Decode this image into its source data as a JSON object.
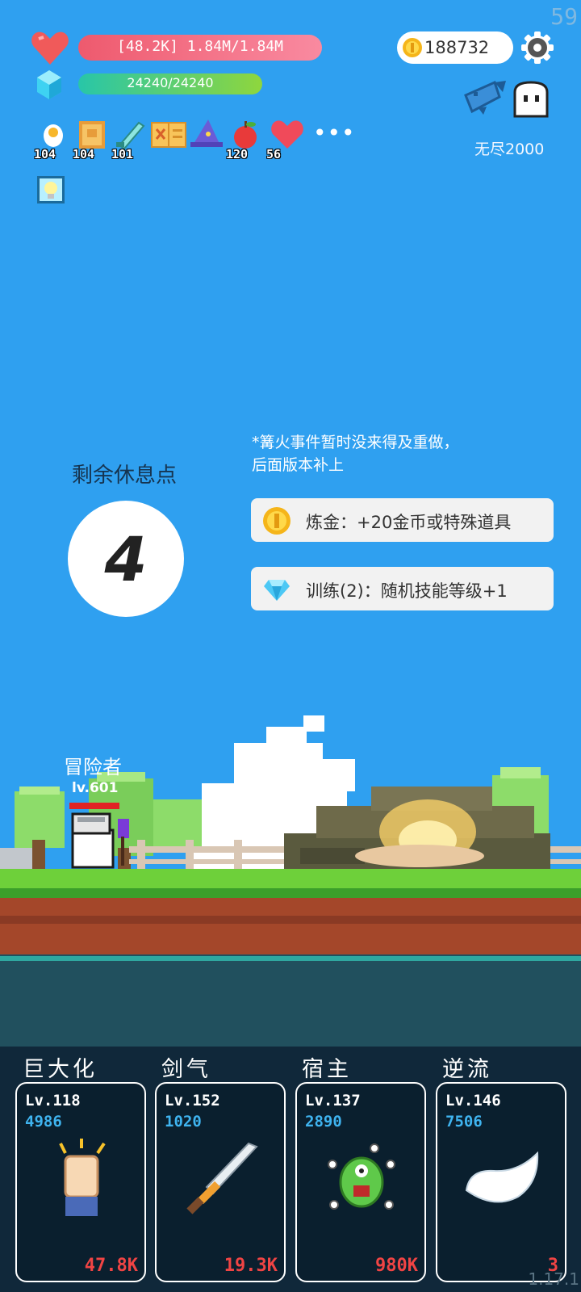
{
  "status": {
    "fps": "59",
    "version": "1.17.1"
  },
  "hud": {
    "hp_text": "[48.2K] 1.84M/1.84M",
    "mp_text": "24240/24240",
    "gold": "188732",
    "mode": "无尽2000"
  },
  "items": [
    {
      "icon": "egg-icon",
      "count": "104"
    },
    {
      "icon": "book-icon",
      "count": "104"
    },
    {
      "icon": "wand-icon",
      "count": "101"
    },
    {
      "icon": "scroll-icon",
      "count": ""
    },
    {
      "icon": "wizard-hat-icon",
      "count": ""
    },
    {
      "icon": "apple-icon",
      "count": "120"
    },
    {
      "icon": "heart-icon",
      "count": "56"
    }
  ],
  "more_label": "•••",
  "campfire": {
    "note": "*篝火事件暂时没来得及重做，\n后面版本补上",
    "rest_title": "剩余休息点",
    "rest_points": "4",
    "options": [
      {
        "icon": "gold-coin-icon",
        "label": "炼金：+20金币或特殊道具"
      },
      {
        "icon": "diamond-icon",
        "label": "训练(2)：随机技能等级+1"
      }
    ]
  },
  "hero": {
    "name": "冒险者",
    "level": "lv.601"
  },
  "skills": [
    {
      "name": "巨大化",
      "level": "Lv.118",
      "cost": "4986",
      "power": "47.8K",
      "icon": "fist-icon"
    },
    {
      "name": "剑气",
      "level": "Lv.152",
      "cost": "1020",
      "power": "19.3K",
      "icon": "sword-icon"
    },
    {
      "name": "宿主",
      "level": "Lv.137",
      "cost": "2890",
      "power": "980K",
      "icon": "monster-icon"
    },
    {
      "name": "逆流",
      "level": "Lv.146",
      "cost": "7506",
      "power": "3",
      "icon": "wing-icon"
    }
  ],
  "colors": {
    "sky": "#2fa0f0",
    "hp": "#ee5a6e",
    "mp": "#28c6a8",
    "panel": "#10283a",
    "cost": "#3fb4f0",
    "power": "#f04444"
  }
}
